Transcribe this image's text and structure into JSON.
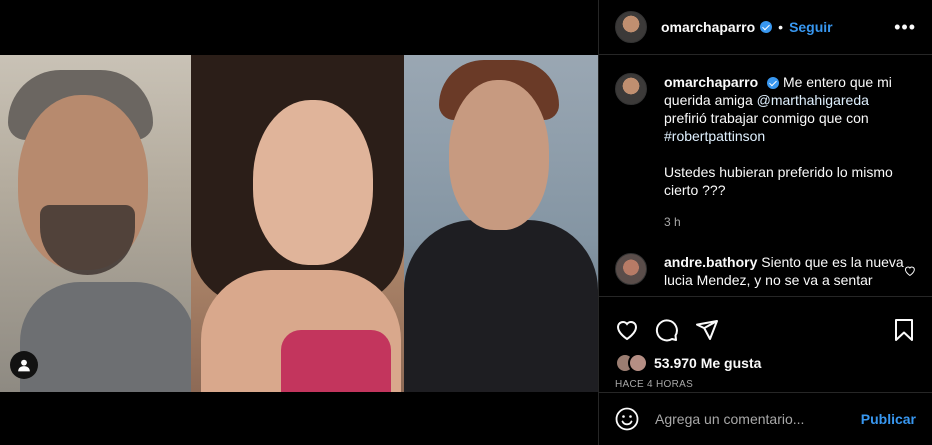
{
  "post": {
    "username": "omarchaparro",
    "follow_label": "Seguir",
    "separator": "•",
    "more_label": "•••"
  },
  "caption": {
    "username": "omarchaparro",
    "text_1": "Me entero que mi querida amiga ",
    "mention": "@marthahigareda",
    "text_2": " prefirió trabajar conmigo que con ",
    "hashtag": "#robertpattinson",
    "text_3": "Ustedes hubieran preferido lo mismo cierto ???",
    "time": "3 h"
  },
  "comments": [
    {
      "username": "andre.bathory",
      "text": "Siento que es la nueva lucia Mendez, y no se va a sentar"
    }
  ],
  "likes": {
    "count_label": "53.970 Me gusta",
    "ago": "HACE 4 HORAS"
  },
  "add_comment": {
    "placeholder": "Agrega un comentario...",
    "publish_label": "Publicar"
  },
  "colors": {
    "accent": "#3897f0",
    "background": "#000000",
    "text": "#fafafa",
    "muted": "#a8a8a8",
    "divider": "#262626"
  },
  "icons": [
    "verified-badge-icon",
    "more-options-icon",
    "heart-icon",
    "comment-icon",
    "share-icon",
    "bookmark-icon",
    "emoji-icon",
    "user-tag-icon"
  ]
}
